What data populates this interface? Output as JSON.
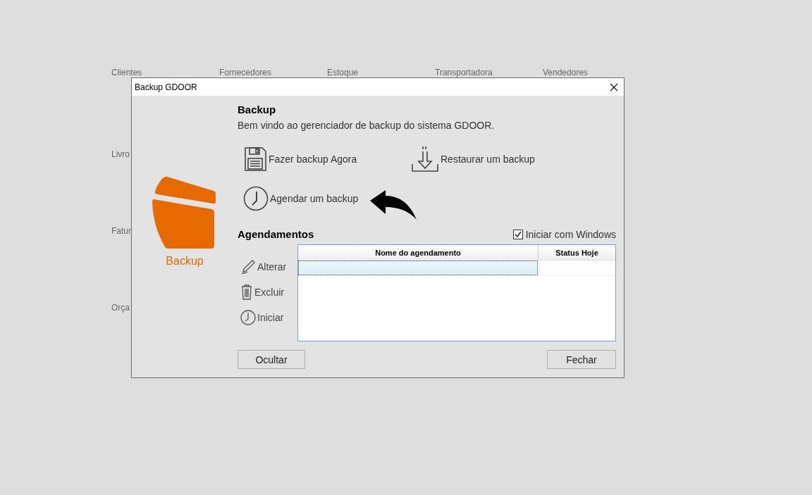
{
  "background_menu": [
    {
      "label": "Clientes"
    },
    {
      "label": "Fornecedores"
    },
    {
      "label": "Estoque"
    },
    {
      "label": "Transportadora"
    },
    {
      "label": "Vendedores"
    },
    {
      "label": "Livro"
    },
    {
      "label": "Fatur"
    },
    {
      "label": "Orça"
    }
  ],
  "dialog": {
    "title": "Backup GDOOR",
    "logo_label": "Backup",
    "heading": "Backup",
    "welcome": "Bem vindo ao gerenciador de backup do sistema GDOOR.",
    "actions": [
      {
        "kind": "save",
        "label": "Fazer backup Agora"
      },
      {
        "kind": "restore",
        "label": "Restaurar um backup"
      },
      {
        "kind": "schedule",
        "label": "Agendar um backup"
      }
    ],
    "schedules": {
      "title": "Agendamentos",
      "start_with_windows": {
        "label": "Iniciar com Windows",
        "checked": true
      },
      "side_actions": [
        {
          "kind": "edit",
          "label": "Alterar"
        },
        {
          "kind": "delete",
          "label": "Excluir"
        },
        {
          "kind": "start",
          "label": "Iniciar"
        }
      ],
      "table": {
        "columns": [
          "Nome do agendamento",
          "Status Hoje"
        ],
        "rows": [
          {
            "selected": true
          }
        ]
      }
    },
    "buttons": [
      "Ocultar",
      "Fechar"
    ]
  }
}
